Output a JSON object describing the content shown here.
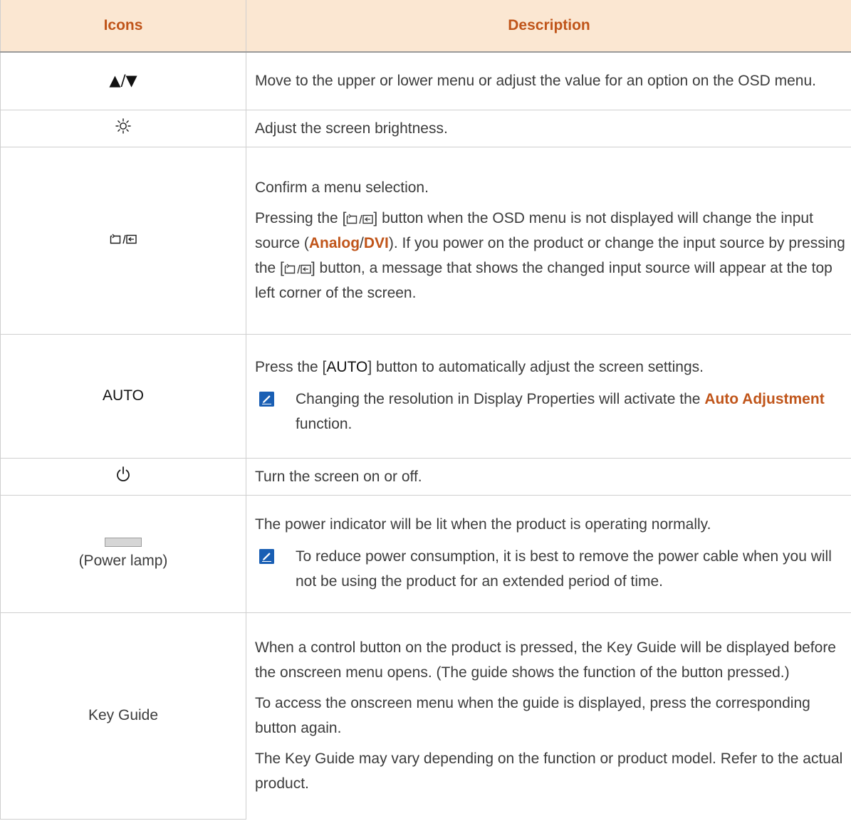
{
  "header": {
    "icons": "Icons",
    "description": "Description"
  },
  "rows": {
    "updown": {
      "icon_label": "▲/▼",
      "desc": "Move to the upper or lower menu or adjust the value for an option on the OSD menu."
    },
    "brightness": {
      "icon_name": "brightness-icon",
      "desc": "Adjust the screen brightness."
    },
    "enter": {
      "icon_name": "menu-source-icon",
      "p1": "Confirm a menu selection.",
      "p2_a": "Pressing the [",
      "p2_b": "] button when the OSD menu is not displayed will change the input source (",
      "p2_analog": "Analog",
      "p2_slash": "/",
      "p2_dvi": "DVI",
      "p2_c": "). If you power on the product or change the input source by pressing the [",
      "p2_d": "] button, a message that shows the changed input source will appear at the top left corner of the screen."
    },
    "auto": {
      "icon_label": "AUTO",
      "p1_a": "Press the [",
      "p1_auto": "AUTO",
      "p1_b": "] button to automatically adjust the screen settings.",
      "note_a": "Changing the resolution in Display Properties will activate the ",
      "note_hl": "Auto Adjustment",
      "note_b": " function."
    },
    "power": {
      "icon_name": "power-icon",
      "desc": "Turn the screen on or off."
    },
    "lamp": {
      "icon_label": "(Power lamp)",
      "p1": "The power indicator will be lit when the product is operating normally.",
      "note": "To reduce power consumption, it is best to remove the power cable when you will not be using the product for an extended period of time."
    },
    "keyguide": {
      "icon_label": "Key Guide",
      "p1": "When a control button on the product is pressed, the Key Guide will be displayed before the onscreen menu opens. (The guide shows the function of the button pressed.)",
      "p2": "To access the onscreen menu when the guide is displayed, press the corresponding button again.",
      "p3": "The Key Guide may vary depending on the function or product model. Refer to the actual product."
    }
  },
  "colors": {
    "header_bg": "#fbe7d2",
    "accent": "#c0551a",
    "note_icon": "#1a5fb4"
  }
}
